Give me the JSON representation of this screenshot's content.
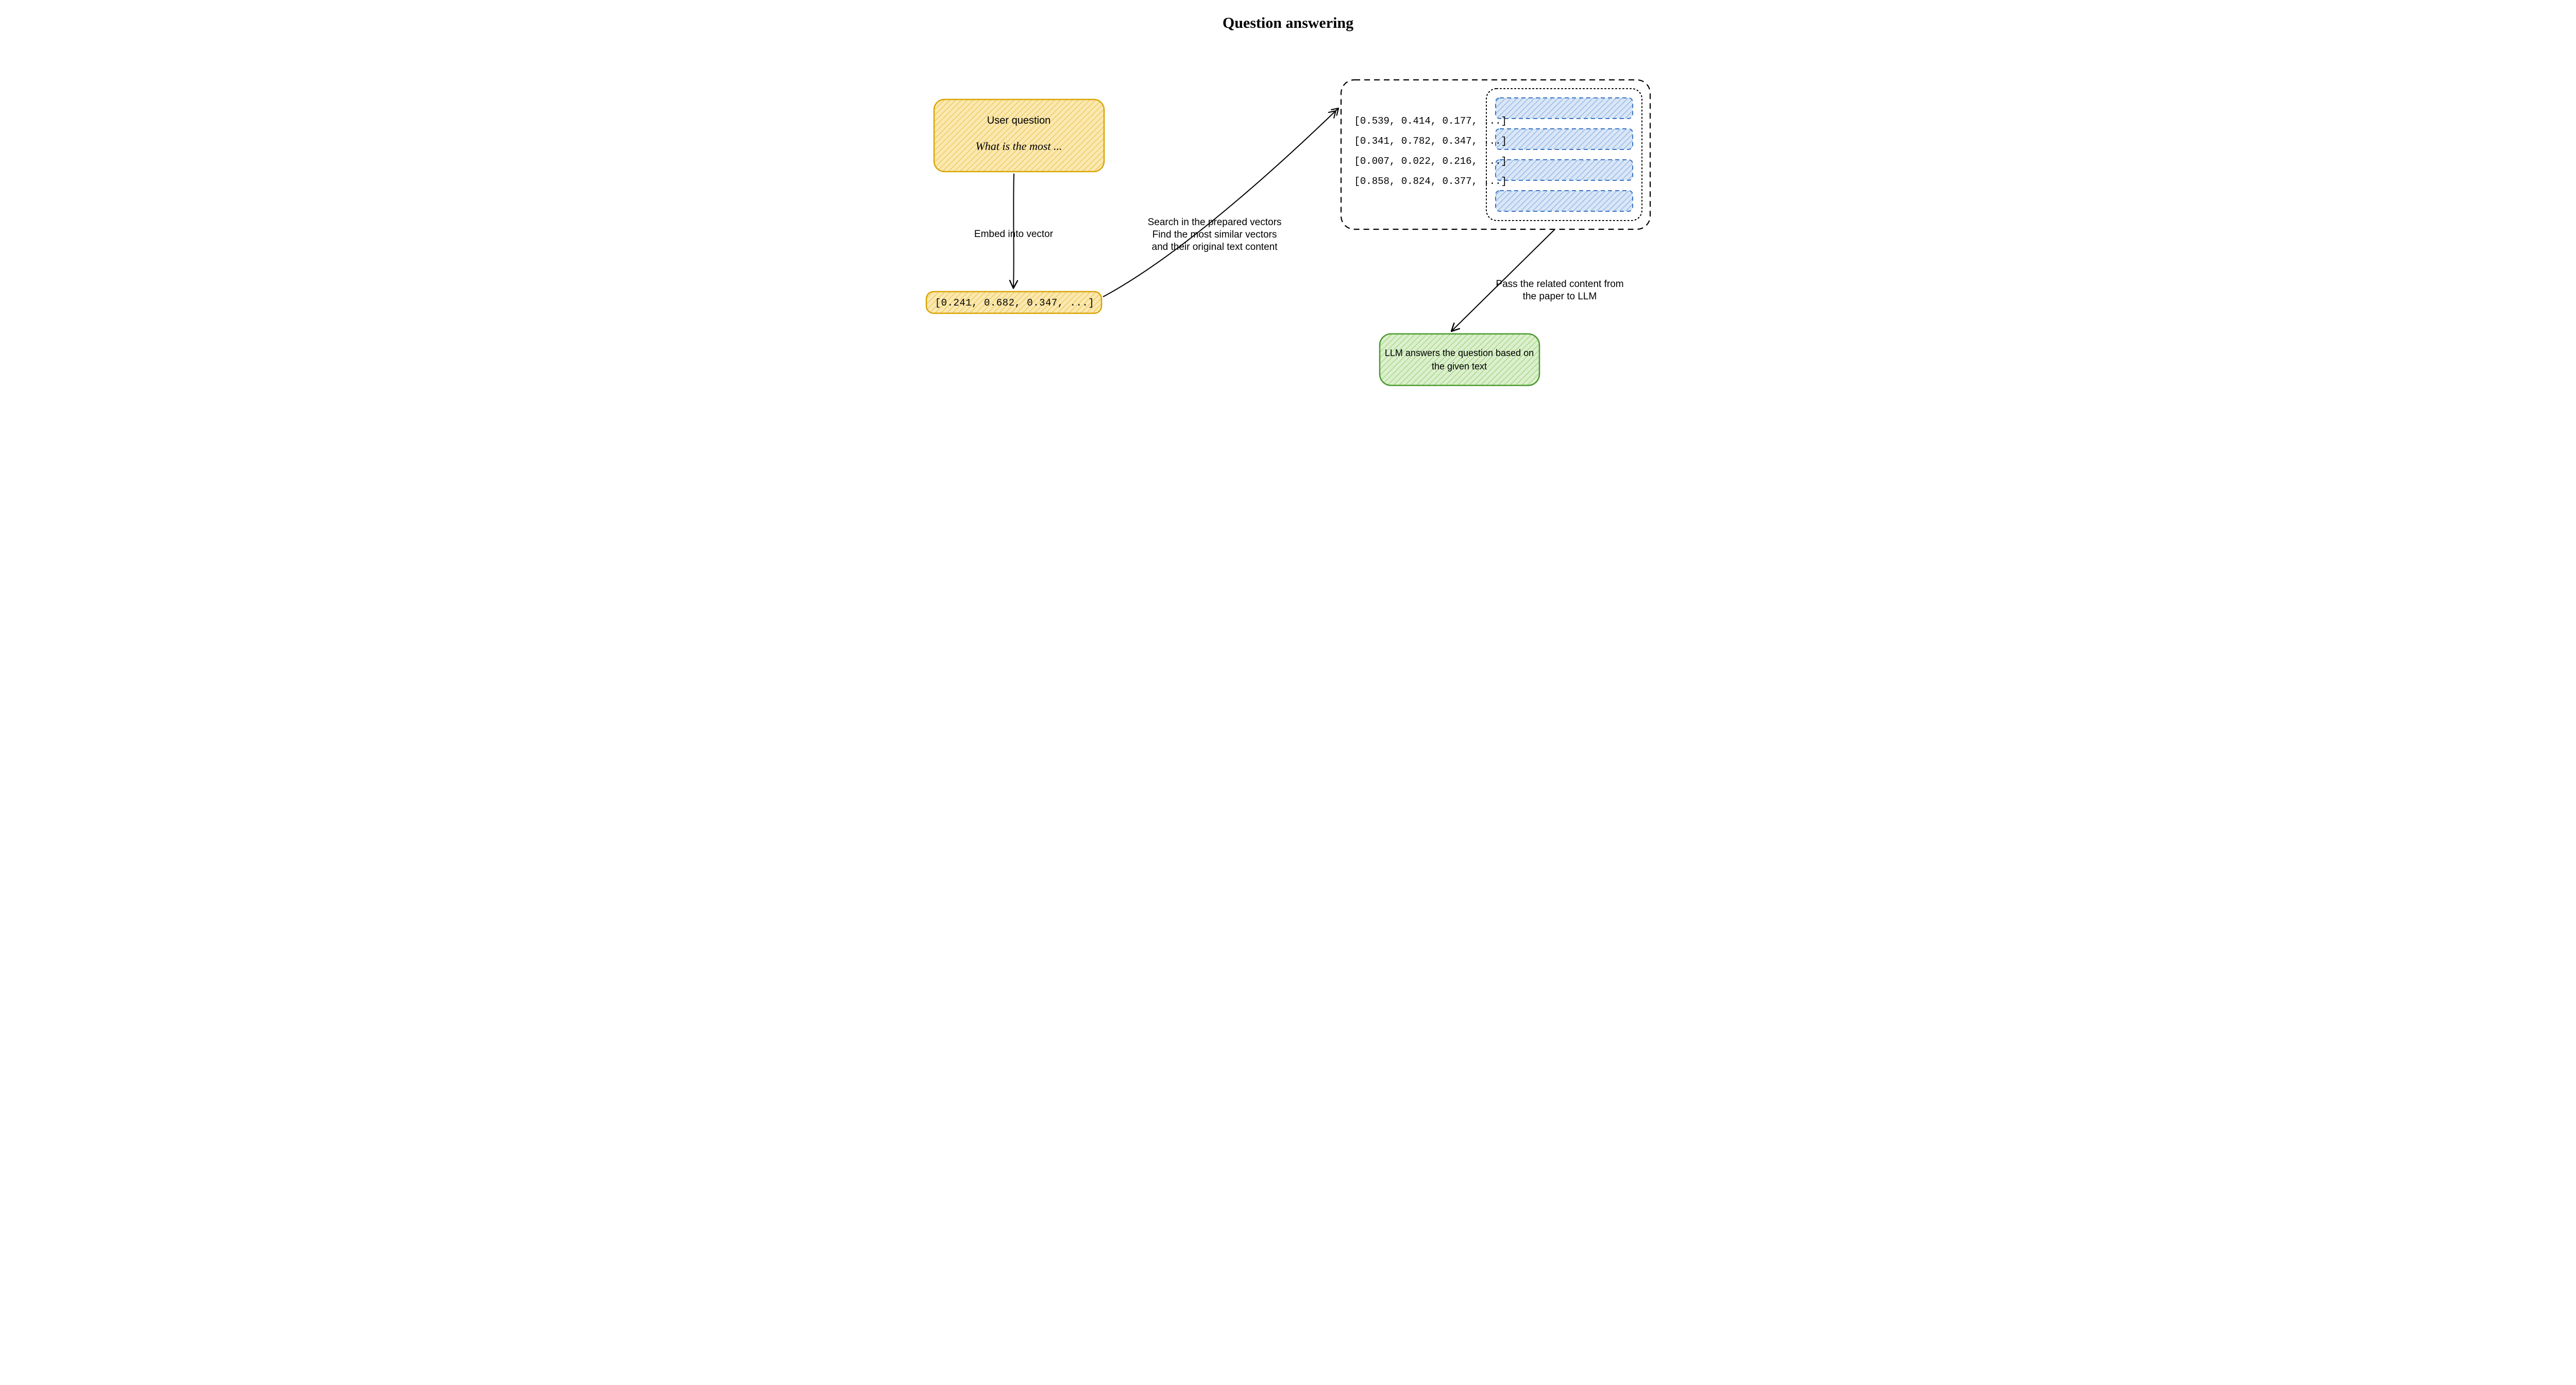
{
  "title": "Question answering",
  "user_box": {
    "label": "User question",
    "example": "What is the most ..."
  },
  "arrows": {
    "embed": "Embed into vector",
    "search": "Search in the prepared vectors\nFind the most similar vectors\nand their original text content",
    "pass": "Pass the related content from\nthe paper to LLM"
  },
  "query_vector": "[0.241, 0.682, 0.347, ...]",
  "db_vectors": [
    "[0.539, 0.414, 0.177, ...]",
    "[0.341, 0.782, 0.347, ...]",
    "[0.007, 0.022, 0.216, ...]",
    "[0.858, 0.824, 0.377, ...]"
  ],
  "llm_box": "LLM answers the question\nbased on the given text",
  "colors": {
    "yellow_stroke": "#d9a404",
    "yellow_fill": "#f5c445",
    "blue_stroke": "#3b76c4",
    "blue_fill": "#7ba8de",
    "green_stroke": "#4a9b2f",
    "green_fill": "#8fce6b",
    "black": "#000000"
  }
}
